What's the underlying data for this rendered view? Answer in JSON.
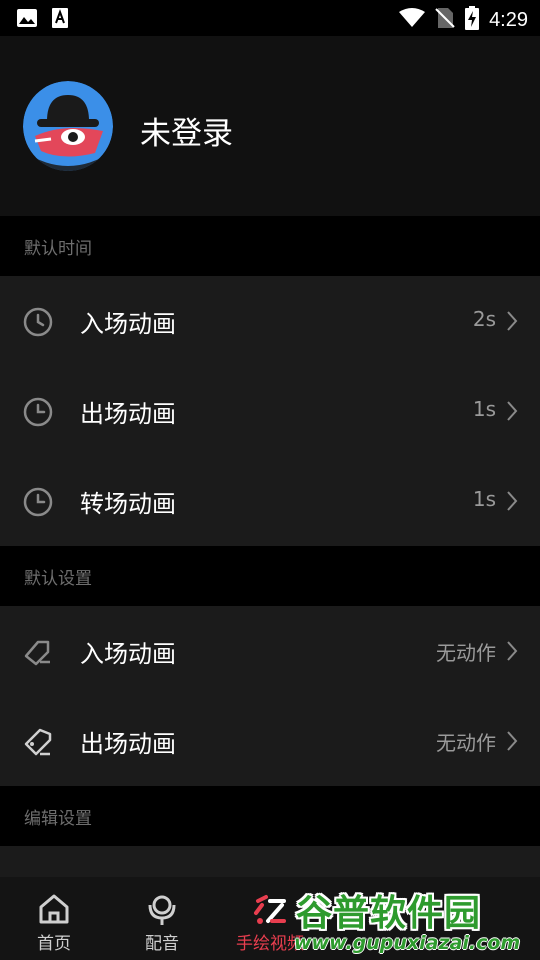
{
  "status_bar": {
    "time": "4:29",
    "left_icons": [
      "image-icon",
      "font-icon"
    ],
    "right_icons": [
      "wifi-icon",
      "no-sim-icon",
      "battery-charging-icon"
    ]
  },
  "profile": {
    "name": "未登录",
    "avatar_icon": "spy-avatar-icon"
  },
  "sections": {
    "default_time": {
      "title": "默认时间",
      "items": [
        {
          "label": "入场动画",
          "value": "2s",
          "icon": "clock-icon"
        },
        {
          "label": "出场动画",
          "value": "1s",
          "icon": "clock-icon"
        },
        {
          "label": "转场动画",
          "value": "1s",
          "icon": "clock-icon"
        }
      ]
    },
    "default_settings": {
      "title": "默认设置",
      "items": [
        {
          "label": "入场动画",
          "value": "无动作",
          "icon": "tag-icon"
        },
        {
          "label": "出场动画",
          "value": "无动作",
          "icon": "tag-icon"
        }
      ]
    },
    "edit_settings": {
      "title": "编辑设置"
    }
  },
  "bottom_nav": {
    "items": [
      {
        "label": "首页",
        "icon": "home-icon",
        "active": false
      },
      {
        "label": "配音",
        "icon": "microphone-icon",
        "active": false
      },
      {
        "label": "手绘视频",
        "icon": "hand-drawn-icon",
        "active": true
      },
      {
        "label": "",
        "icon": "",
        "active": false
      },
      {
        "label": "",
        "icon": "",
        "active": false
      }
    ]
  },
  "watermark": {
    "title": "谷普软件园",
    "url": "www.gupuxiazai.com"
  },
  "colors": {
    "background": "#000000",
    "card": "#1b1b1b",
    "accent": "#e83e4f",
    "muted_text": "#6e6e6e",
    "value_text": "#9a9a9a"
  }
}
